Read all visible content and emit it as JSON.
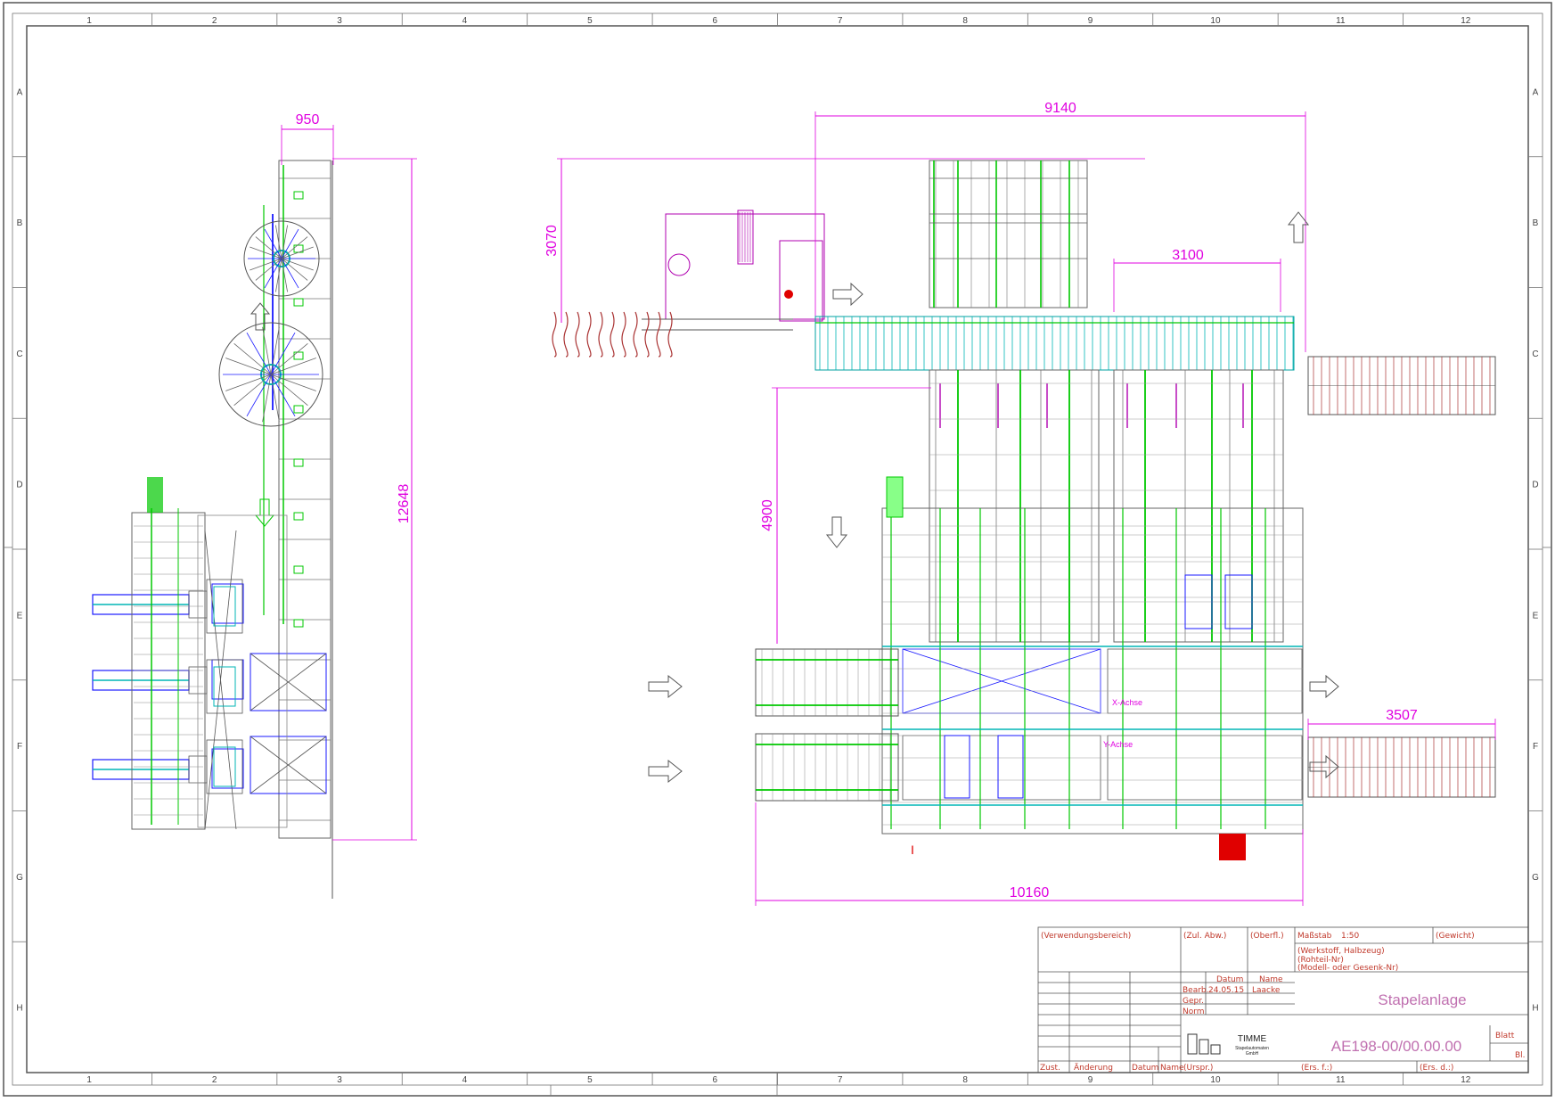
{
  "grid": {
    "columns": [
      "1",
      "2",
      "3",
      "4",
      "5",
      "6",
      "7",
      "8",
      "9",
      "10",
      "11",
      "12"
    ],
    "rows": [
      "A",
      "B",
      "C",
      "D",
      "E",
      "F",
      "G",
      "H"
    ]
  },
  "dimensions": {
    "d950": "950",
    "d12648": "12648",
    "d3070": "3070",
    "d9140": "9140",
    "d3100": "3100",
    "d4900": "4900",
    "d3507": "3507",
    "d10160": "10160"
  },
  "axis_labels": {
    "x_axis": "X-Achse",
    "y_axis": "Y-Achse"
  },
  "title_block": {
    "verwendungsbereich": "(Verwendungsbereich)",
    "zul_abw": "(Zul. Abw.)",
    "oberfl": "(Oberfl.)",
    "massstab_label": "Maßstab",
    "massstab_value": "1:50",
    "gewicht": "(Gewicht)",
    "werkstoff": "(Werkstoff, Halbzeug)",
    "rohteil": "(Rohteil-Nr)",
    "modell": "(Modell- oder Gesenk-Nr)",
    "datum_header": "Datum",
    "name_header": "Name",
    "bearb_label": "Bearb.",
    "bearb_date": "24.05.15",
    "bearb_name": "Laacke",
    "gepr_label": "Gepr.",
    "norm_label": "Norm",
    "company": "TIMME",
    "company_sub1": "Stapelautomaten",
    "company_sub2": "GmbH",
    "title": "Stapelanlage",
    "drawing_no": "AE198-00/00.00.00",
    "blatt": "Blatt",
    "bl": "Bl.",
    "zust": "Zust.",
    "aenderung": "Änderung",
    "datum_footer": "Datum",
    "name_footer": "Name",
    "urspr": "(Urspr.)",
    "ers_f": "(Ers. f.:)",
    "ers_d": "(Ers. d.:)"
  },
  "colors": {
    "frame": "#555555",
    "magenta": "#e000e0",
    "green": "#00c800",
    "blue": "#1a1aff",
    "cyan": "#00b5b5",
    "red": "#e00000",
    "dark_red": "#a33",
    "grey_line": "#666666",
    "title_text": "#c0392b"
  }
}
